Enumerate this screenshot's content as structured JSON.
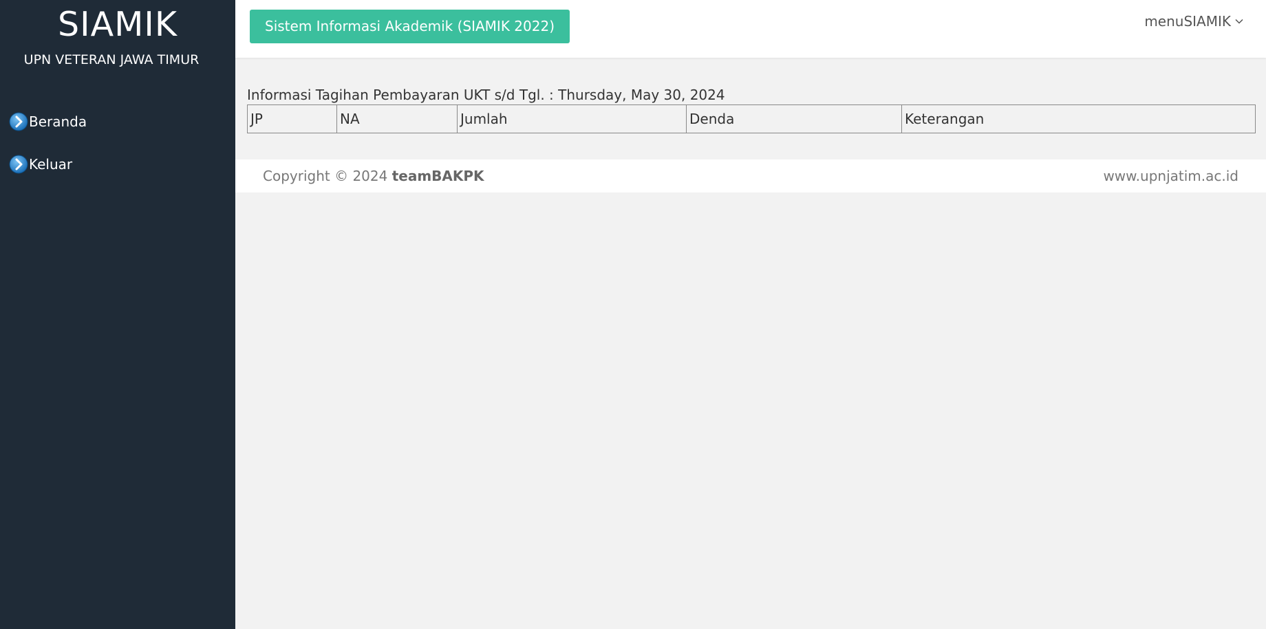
{
  "sidebar": {
    "title": "SIAMIK",
    "subtitle": "UPN VETERAN JAWA TIMUR",
    "items": [
      {
        "label": "Beranda",
        "icon": "chevron-right-circle-icon"
      },
      {
        "label": "Keluar",
        "icon": "chevron-right-circle-icon"
      }
    ]
  },
  "topbar": {
    "app_button_label": "Sistem Informasi Akademik (SIAMIK 2022)",
    "menu_label": "menuSIAMIK",
    "menu_icon": "chevron-down-icon"
  },
  "main": {
    "info_title": "Informasi Tagihan Pembayaran UKT s/d Tgl. : Thursday, May 30, 2024",
    "table": {
      "columns": [
        "JP",
        "NA",
        "Jumlah",
        "Denda",
        "Keterangan"
      ],
      "rows": []
    }
  },
  "footer": {
    "copyright_prefix": "Copyright © 2024",
    "copyright_team": "teamBAKPK",
    "site": "www.upnjatim.ac.id"
  },
  "colors": {
    "sidebar_bg": "#1f2b37",
    "accent": "#3bbf9d",
    "page_bg": "#f2f2f2",
    "icon_blue": "#2b8fd6"
  }
}
